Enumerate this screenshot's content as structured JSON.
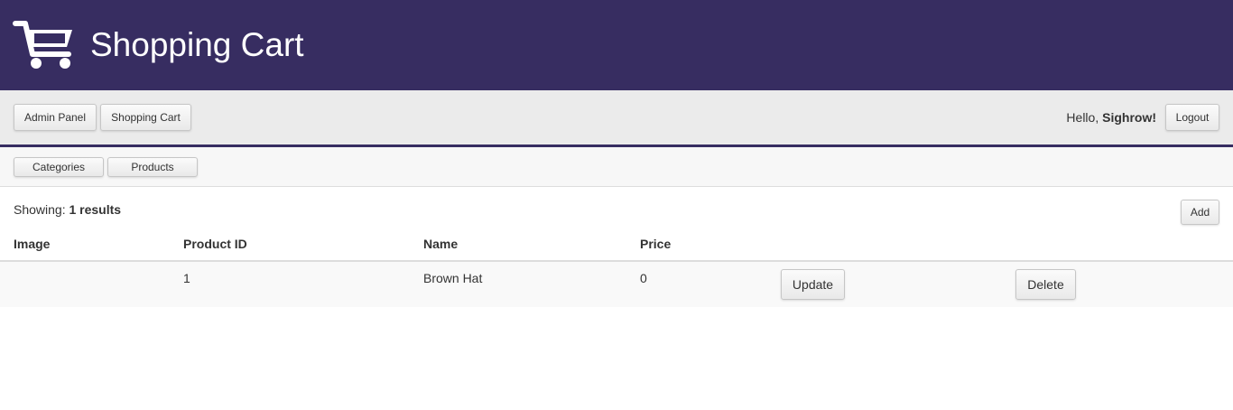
{
  "header": {
    "title": "Shopping Cart",
    "logo_icon": "shopping-cart-icon",
    "background": "#372d61"
  },
  "navbar": {
    "admin_panel_label": "Admin Panel",
    "shopping_cart_label": "Shopping Cart",
    "greeting_prefix": "Hello,",
    "username": "Sighrow!",
    "logout_label": "Logout"
  },
  "subnav": {
    "categories_label": "Categories",
    "products_label": "Products"
  },
  "results": {
    "showing_label": "Showing:",
    "count_text": "1 results",
    "add_label": "Add"
  },
  "table": {
    "columns": [
      "Image",
      "Product ID",
      "Name",
      "Price"
    ],
    "rows": [
      {
        "image": "",
        "product_id": "1",
        "name": "Brown Hat",
        "price": "0",
        "update_label": "Update",
        "delete_label": "Delete"
      }
    ]
  }
}
